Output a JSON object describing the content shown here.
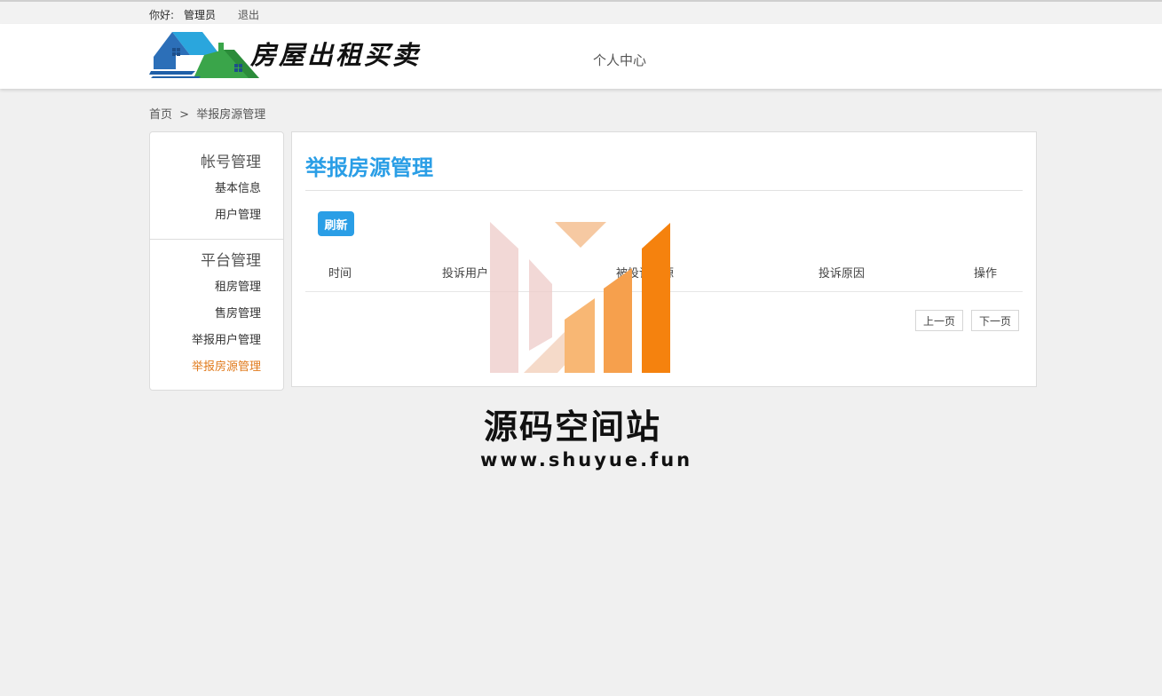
{
  "topbar": {
    "greeting": "你好:",
    "username": "管理员",
    "logout": "退出"
  },
  "header": {
    "site_title": "房屋出租买卖",
    "nav_personal_center": "个人中心"
  },
  "breadcrumb": {
    "home": "首页",
    "separator": ">",
    "current": "举报房源管理"
  },
  "sidebar": {
    "groups": [
      {
        "title": "帐号管理",
        "items": [
          {
            "label": "基本信息",
            "active": false
          },
          {
            "label": "用户管理",
            "active": false
          }
        ]
      },
      {
        "title": "平台管理",
        "items": [
          {
            "label": "租房管理",
            "active": false
          },
          {
            "label": "售房管理",
            "active": false
          },
          {
            "label": "举报用户管理",
            "active": false
          },
          {
            "label": "举报房源管理",
            "active": true
          }
        ]
      }
    ]
  },
  "main": {
    "title": "举报房源管理",
    "refresh_label": "刷新",
    "columns": [
      "时间",
      "投诉用户",
      "被投诉房源",
      "投诉原因",
      "操作"
    ],
    "rows": [],
    "pager": {
      "prev": "上一页",
      "next": "下一页"
    }
  },
  "watermark": {
    "title": "源码空间站",
    "url": "www.shuyue.fun"
  },
  "colors": {
    "accent_blue": "#2a9ee6",
    "active_orange": "#e07a1c",
    "page_bg": "#f0f0f0"
  }
}
